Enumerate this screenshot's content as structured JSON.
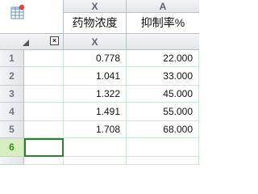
{
  "columns": [
    {
      "letter": "X",
      "name": "药物浓度",
      "sub": "X"
    },
    {
      "letter": "A",
      "name": "抑制率%",
      "sub": ""
    }
  ],
  "corner": {
    "close_glyph": "×"
  },
  "rows": [
    {
      "num": "1",
      "x": "0.778",
      "a": "22.000"
    },
    {
      "num": "2",
      "x": "1.041",
      "a": "33.000"
    },
    {
      "num": "3",
      "x": "1.322",
      "a": "45.000"
    },
    {
      "num": "4",
      "x": "1.491",
      "a": "55.000"
    },
    {
      "num": "5",
      "x": "1.708",
      "a": "68.000"
    },
    {
      "num": "6",
      "x": "",
      "a": ""
    },
    {
      "num": "",
      "x": "",
      "a": ""
    }
  ],
  "colors": {
    "accent_green": "#2e7d32",
    "active_row": "#d7efbf",
    "gridline": "#c9e8d2",
    "icon_red": "#e0453a"
  },
  "icons": {
    "table_icon": "table-grid-icon",
    "corner_sort": "sort-triangle-icon",
    "corner_close": "close-icon"
  }
}
